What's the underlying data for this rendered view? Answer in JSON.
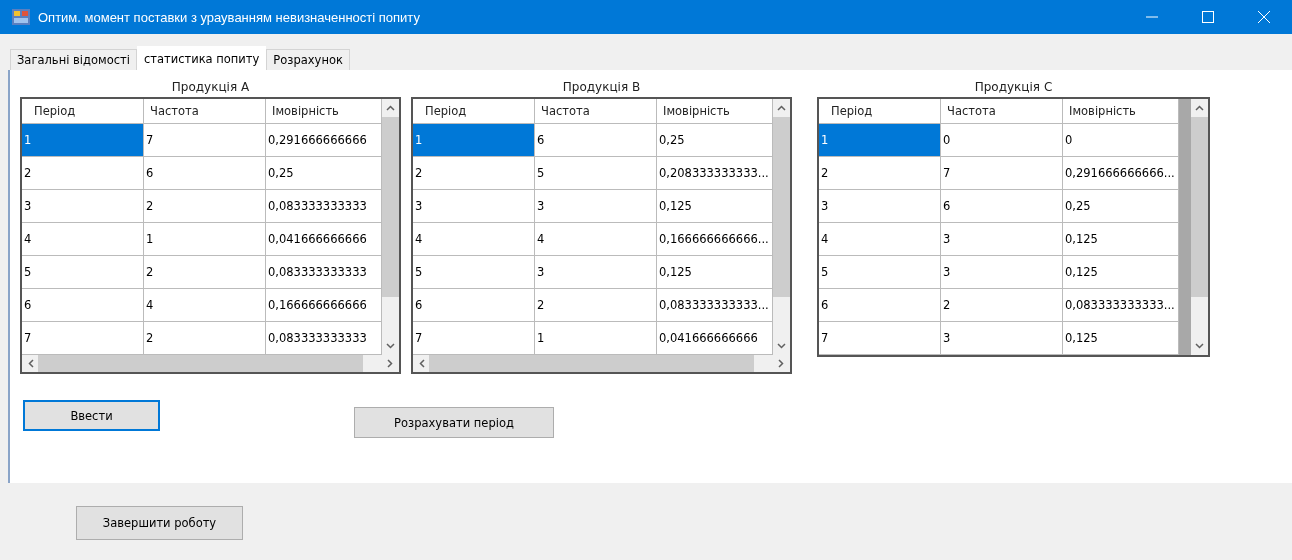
{
  "window": {
    "title": "Оптим. момент поставки з урауванням невизначенності попиту"
  },
  "tabs": [
    {
      "label": "Загальні відомості",
      "selected": false
    },
    {
      "label": "статистика попиту",
      "selected": true
    },
    {
      "label": "Розрахунок",
      "selected": false
    }
  ],
  "grids": [
    {
      "title": "Продукція А",
      "columns": [
        "Період",
        "Частота",
        "Імовірність"
      ],
      "horizontal_scrollbar": true,
      "rows": [
        {
          "selected": true,
          "cells": [
            "1",
            "7",
            "0,291666666666"
          ]
        },
        {
          "selected": false,
          "cells": [
            "2",
            "6",
            "0,25"
          ]
        },
        {
          "selected": false,
          "cells": [
            "3",
            "2",
            "0,083333333333"
          ]
        },
        {
          "selected": false,
          "cells": [
            "4",
            "1",
            "0,041666666666"
          ]
        },
        {
          "selected": false,
          "cells": [
            "5",
            "2",
            "0,083333333333"
          ]
        },
        {
          "selected": false,
          "cells": [
            "6",
            "4",
            "0,166666666666"
          ]
        },
        {
          "selected": false,
          "cells": [
            "7",
            "2",
            "0,083333333333"
          ]
        }
      ]
    },
    {
      "title": "Продукція В",
      "columns": [
        "Період",
        "Частота",
        "Імовірність"
      ],
      "horizontal_scrollbar": true,
      "rows": [
        {
          "selected": true,
          "cells": [
            "1",
            "6",
            "0,25"
          ]
        },
        {
          "selected": false,
          "cells": [
            "2",
            "5",
            "0,208333333333..."
          ]
        },
        {
          "selected": false,
          "cells": [
            "3",
            "3",
            "0,125"
          ]
        },
        {
          "selected": false,
          "cells": [
            "4",
            "4",
            "0,166666666666..."
          ]
        },
        {
          "selected": false,
          "cells": [
            "5",
            "3",
            "0,125"
          ]
        },
        {
          "selected": false,
          "cells": [
            "6",
            "2",
            "0,083333333333..."
          ]
        },
        {
          "selected": false,
          "cells": [
            "7",
            "1",
            "0,041666666666"
          ]
        }
      ]
    },
    {
      "title": "Продукція С",
      "columns": [
        "Період",
        "Частота",
        "Імовірність"
      ],
      "horizontal_scrollbar": false,
      "rows": [
        {
          "selected": true,
          "cells": [
            "1",
            "0",
            "0"
          ]
        },
        {
          "selected": false,
          "cells": [
            "2",
            "7",
            "0,291666666666..."
          ]
        },
        {
          "selected": false,
          "cells": [
            "3",
            "6",
            "0,25"
          ]
        },
        {
          "selected": false,
          "cells": [
            "4",
            "3",
            "0,125"
          ]
        },
        {
          "selected": false,
          "cells": [
            "5",
            "3",
            "0,125"
          ]
        },
        {
          "selected": false,
          "cells": [
            "6",
            "2",
            "0,083333333333..."
          ]
        },
        {
          "selected": false,
          "cells": [
            "7",
            "3",
            "0,125"
          ]
        }
      ]
    }
  ],
  "tab_buttons": [
    {
      "label": "Ввести",
      "focused": true
    },
    {
      "label": "Розрахувати період",
      "focused": false
    }
  ],
  "footer_button": {
    "label": "Завершити роботу"
  }
}
